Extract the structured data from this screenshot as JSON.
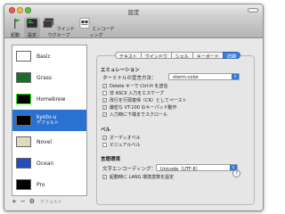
{
  "window": {
    "title": "設定"
  },
  "toolbar": {
    "items": [
      {
        "label": "起動",
        "icon": "startup-icon"
      },
      {
        "label": "設定",
        "icon": "settings-icon"
      },
      {
        "label": "ウインドウグループ",
        "icon": "window-groups-icon"
      },
      {
        "label": "エンコーディング",
        "icon": "encodings-icon"
      }
    ],
    "selected_index": 1
  },
  "profiles": [
    {
      "name": "Basic",
      "subtitle": "",
      "colors": {
        "bg": "#ffffff",
        "fg": "#000000"
      }
    },
    {
      "name": "Grass",
      "subtitle": "",
      "colors": {
        "bg": "#1d6b2f",
        "fg": "#ffff9a"
      }
    },
    {
      "name": "Homebrew",
      "subtitle": "",
      "colors": {
        "bg": "#000000",
        "fg": "#28fe14"
      }
    },
    {
      "name": "kyoto-u",
      "subtitle": "デフォルト",
      "colors": {
        "bg": "#000000",
        "fg": "#ffffff"
      }
    },
    {
      "name": "Novel",
      "subtitle": "",
      "colors": {
        "bg": "#dfdbc3",
        "fg": "#3b2322"
      }
    },
    {
      "name": "Ocean",
      "subtitle": "",
      "colors": {
        "bg": "#224fbc",
        "fg": "#ffffff"
      }
    },
    {
      "name": "Pro",
      "subtitle": "",
      "colors": {
        "bg": "#000000",
        "fg": "#f2f2f2"
      }
    }
  ],
  "selected_profile_index": 3,
  "list_buttons": {
    "add": "+",
    "remove": "−",
    "gear": "⚙",
    "default": "デフォルト"
  },
  "tabs": [
    "テキスト",
    "ウインドウ",
    "シェル",
    "キーボード",
    "詳細"
  ],
  "active_tab_index": 4,
  "emulation": {
    "title": "エミュレーション",
    "terminal_label": "ターミナルの宣言方法：",
    "terminal_value": "xterm-color",
    "checks": [
      {
        "label": "Delete キーで Ctrl-H を送信",
        "checked": true
      },
      {
        "label": "非 ASCII 入力をエスケープ",
        "checked": false
      },
      {
        "label": "改行を行頭復帰（CR）としてペースト",
        "checked": true
      },
      {
        "label": "厳密な VT-100 のキーパッド動作",
        "checked": true
      },
      {
        "label": "入力時に下端までスクロール",
        "checked": true
      }
    ]
  },
  "bell": {
    "title": "ベル",
    "checks": [
      {
        "label": "オーディオベル",
        "checked": true
      },
      {
        "label": "ビジュアルベル",
        "checked": false
      }
    ]
  },
  "international": {
    "title": "言語環境",
    "encoding_label": "文字エンコーディング：",
    "encoding_value": "Unicode（UTF-8）",
    "lang_check": {
      "label": "起動時に LANG 環境変数を設定",
      "checked": true
    }
  },
  "help": "?",
  "colors": {
    "accent": "#3d80d7",
    "selection": "#2a71d1"
  }
}
